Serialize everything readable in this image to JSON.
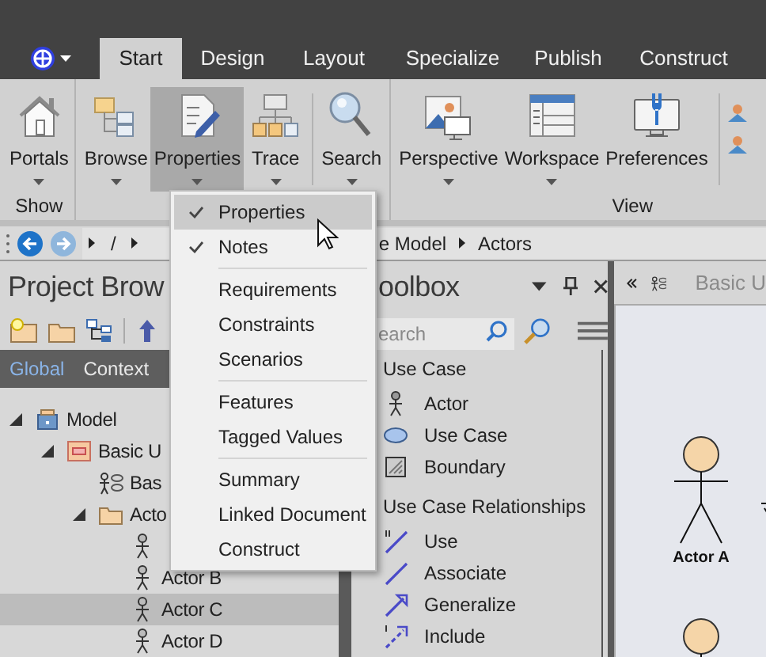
{
  "tabs": [
    {
      "label": "Start",
      "selected": true
    },
    {
      "label": "Design",
      "selected": false
    },
    {
      "label": "Layout",
      "selected": false
    },
    {
      "label": "Specialize",
      "selected": false
    },
    {
      "label": "Publish",
      "selected": false
    },
    {
      "label": "Construct",
      "selected": false
    }
  ],
  "ribbon": {
    "groups": [
      {
        "label": "Show",
        "buttons": [
          {
            "label": "Portals",
            "dropdown": true,
            "active": false,
            "divider_before": false
          }
        ]
      },
      {
        "buttons": [
          {
            "label": "Browse",
            "dropdown": true,
            "active": false,
            "divider_before": false
          },
          {
            "label": "Properties",
            "dropdown": true,
            "active": true,
            "divider_before": false
          },
          {
            "label": "Trace",
            "dropdown": true,
            "active": false,
            "divider_before": false
          },
          {
            "label": "Search",
            "dropdown": true,
            "active": false,
            "divider_before": true
          }
        ]
      },
      {
        "label": "View",
        "buttons": [
          {
            "label": "Perspective",
            "dropdown": true,
            "active": false,
            "divider_before": false
          },
          {
            "label": "Workspace",
            "dropdown": true,
            "active": false,
            "divider_before": false
          },
          {
            "label": "Preferences",
            "dropdown": false,
            "active": false,
            "divider_before": false
          }
        ]
      }
    ]
  },
  "breadcrumb": {
    "path": [
      "/",
      "e Model",
      "Actors"
    ]
  },
  "project_browser": {
    "title": "Project Brow",
    "tabs": [
      {
        "label": "Global",
        "selected": true
      },
      {
        "label": "Context",
        "selected": false
      }
    ],
    "tree": [
      {
        "kind": "model",
        "label": "Model",
        "expanded": true,
        "selected": false,
        "children": [
          {
            "kind": "package",
            "label": "Basic U",
            "expanded": true,
            "selected": false,
            "children": [
              {
                "kind": "diagram",
                "label": "Bas",
                "selected": false
              },
              {
                "kind": "folder",
                "label": "Acto",
                "expanded": true,
                "selected": false,
                "children": [
                  {
                    "kind": "actor",
                    "selected": false
                  },
                  {
                    "kind": "actor",
                    "label": "Actor B",
                    "selected": false
                  },
                  {
                    "kind": "actor",
                    "label": "Actor C",
                    "selected": true
                  },
                  {
                    "kind": "actor",
                    "label": "Actor D",
                    "selected": false
                  }
                ]
              }
            ]
          }
        ]
      }
    ]
  },
  "toolbox": {
    "title": "oolbox",
    "search": {
      "placeholder": "earch"
    },
    "sections": [
      {
        "title": "Use Case",
        "items": [
          "Actor",
          "Use Case",
          "Boundary"
        ]
      },
      {
        "title": "Use Case Relationships",
        "items": [
          "Use",
          "Associate",
          "Generalize",
          "Include"
        ]
      }
    ]
  },
  "diagram": {
    "tab": "Basic U",
    "elements": [
      {
        "kind": "actor",
        "label": "Actor A"
      },
      {
        "kind": "actor"
      }
    ]
  },
  "context_menu": {
    "groups": [
      [
        {
          "label": "Properties",
          "checked": true,
          "highlighted": true
        },
        {
          "label": "Notes",
          "checked": true,
          "highlighted": false
        }
      ],
      [
        {
          "label": "Requirements",
          "checked": false,
          "highlighted": false
        },
        {
          "label": "Constraints",
          "checked": false,
          "highlighted": false
        },
        {
          "label": "Scenarios",
          "checked": false,
          "highlighted": false
        }
      ],
      [
        {
          "label": "Features",
          "checked": false,
          "highlighted": false
        },
        {
          "label": "Tagged Values",
          "checked": false,
          "highlighted": false
        }
      ],
      [
        {
          "label": "Summary",
          "checked": false,
          "highlighted": false
        },
        {
          "label": "Linked Document",
          "checked": false,
          "highlighted": false
        },
        {
          "label": "Construct",
          "checked": false,
          "highlighted": false
        }
      ]
    ]
  }
}
